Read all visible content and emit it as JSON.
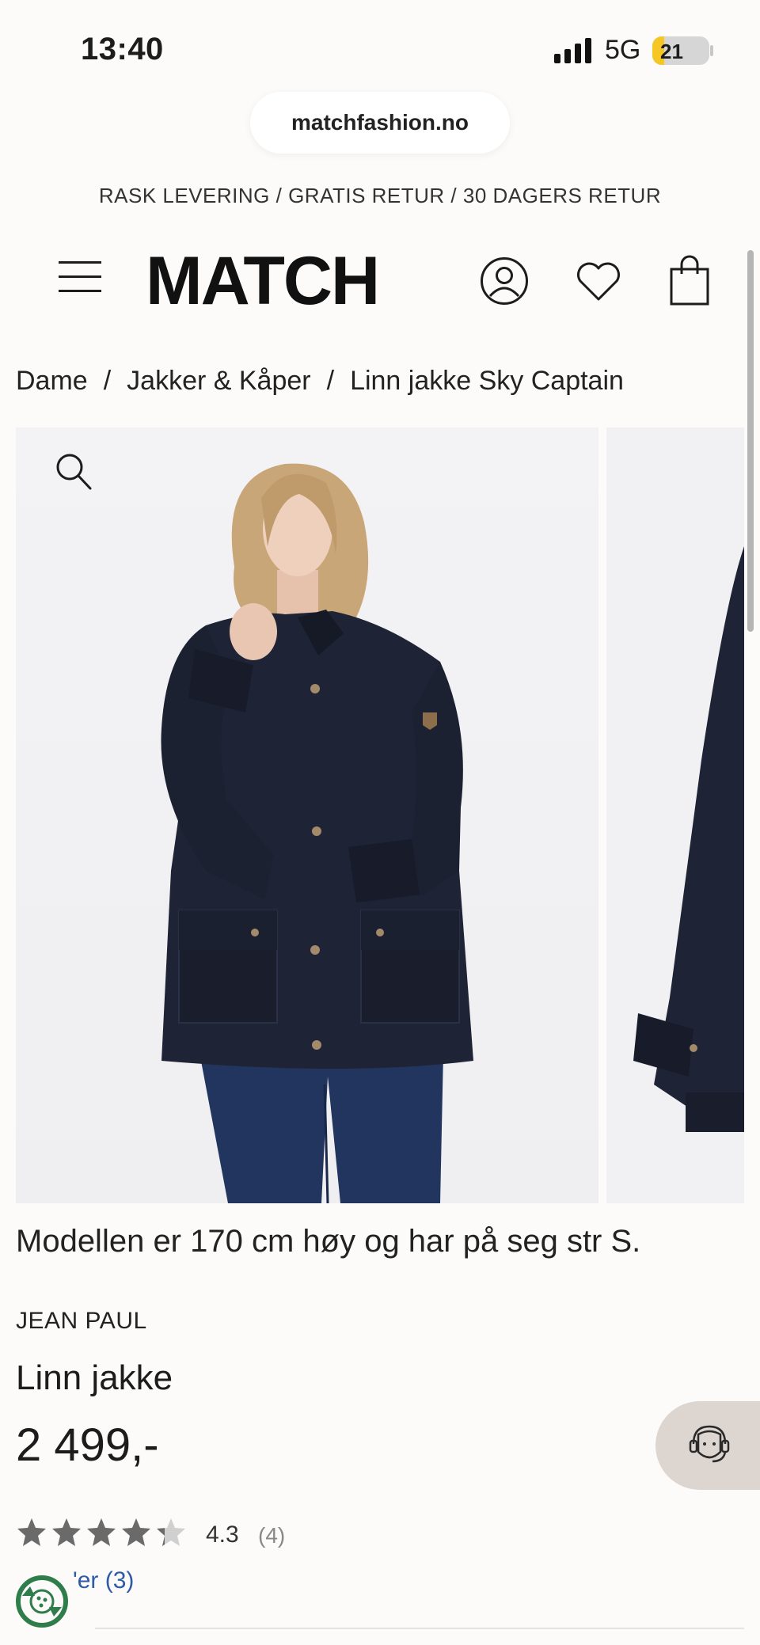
{
  "status_bar": {
    "time": "13:40",
    "network": "5G",
    "battery": "21",
    "battery_level": 0.21
  },
  "browser": {
    "url": "matchfashion.no"
  },
  "promo": "RASK LEVERING / GRATIS RETUR / 30 DAGERS RETUR",
  "header": {
    "logo": "MATCH"
  },
  "breadcrumb": [
    "Dame",
    "Jakker & Kåper",
    "Linn jakke Sky Captain"
  ],
  "breadcrumb_separator": "/",
  "product": {
    "model_caption": "Modellen er 170 cm høy og har på seg str S.",
    "brand": "JEAN PAUL",
    "name": "Linn jakke",
    "price": "2 499,-",
    "rating": "4.3",
    "rating_count": "(4)",
    "rating_stars_filled": 4.3,
    "rating_stars_total": 5,
    "reviews_link": "'er (3)"
  },
  "colors": {
    "background": "#fdfbfa",
    "jacket": "#1e2335",
    "jeans": "#22355e",
    "chat_button": "#ddd5cf",
    "link": "#2e5aa8",
    "star": "#6a6a6a"
  },
  "icons": {
    "menu": "hamburger-icon",
    "account": "user-icon",
    "wishlist": "heart-icon",
    "cart": "shopping-bag-icon",
    "zoom": "search-icon",
    "chat": "support-agent-icon"
  }
}
